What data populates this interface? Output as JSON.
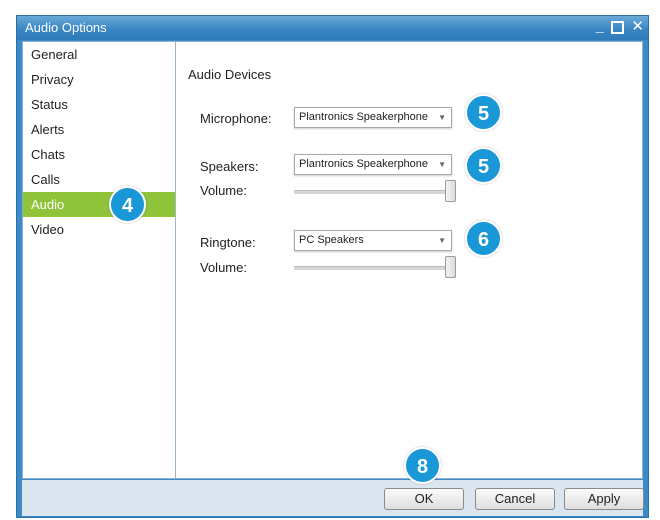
{
  "window": {
    "title": "Audio Options",
    "controls": {
      "minimize": "_",
      "close": "✕"
    }
  },
  "sidebar": {
    "items": [
      {
        "label": "General"
      },
      {
        "label": "Privacy"
      },
      {
        "label": "Status"
      },
      {
        "label": "Alerts"
      },
      {
        "label": "Chats"
      },
      {
        "label": "Calls"
      },
      {
        "label": "Audio",
        "selected": true
      },
      {
        "label": "Video"
      }
    ]
  },
  "content": {
    "section_title": "Audio Devices",
    "microphone": {
      "label": "Microphone:",
      "value": "Plantronics Speakerphone"
    },
    "speakers": {
      "label": "Speakers:",
      "value": "Plantronics Speakerphone",
      "volume_label": "Volume:",
      "volume_level": 1.0
    },
    "ringtone": {
      "label": "Ringtone:",
      "value": "PC Speakers",
      "volume_label": "Volume:",
      "volume_level": 1.0
    },
    "dropdown_arrow": "▼"
  },
  "footer": {
    "ok": "OK",
    "cancel": "Cancel",
    "apply": "Apply"
  },
  "callouts": {
    "audio": "4",
    "microphone": "5",
    "speakers": "5",
    "ringtone": "6",
    "ok": "8"
  },
  "colors": {
    "titlebar": "#3a86c4",
    "selected_item": "#8fc43a",
    "callout": "#1997d6",
    "footer": "#dbe6f0"
  }
}
